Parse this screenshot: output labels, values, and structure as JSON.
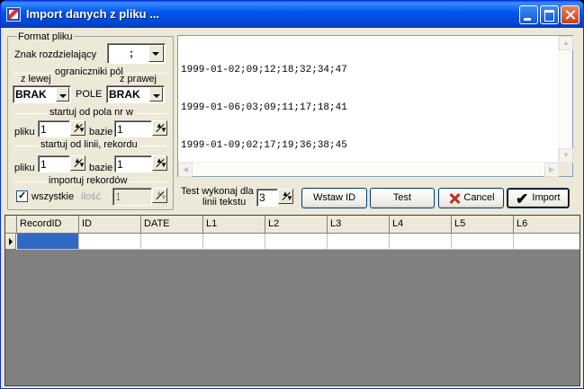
{
  "window": {
    "title": "Import danych z pliku ..."
  },
  "format": {
    "group_title": "Format pliku",
    "separator_label": "Znak rozdzielający",
    "separator_value": ";",
    "delimiters_title": "ograniczniki pól",
    "left_label": "z lewej",
    "right_label": "z prawej",
    "left_value": "BRAK",
    "right_value": "BRAK",
    "field_label": "POLE",
    "start_field_title": "startuj od pola nr w",
    "start_line_title": "startuj od linii, rekordu",
    "file_label": "pliku",
    "base_label": "bazie",
    "start_field_file": "1",
    "start_field_base": "1",
    "start_line_file": "1",
    "start_line_base": "1",
    "import_title": "importuj rekordów",
    "all_label": "wszystkie",
    "all_checked": true,
    "count_label": "ilość",
    "count_value": "1"
  },
  "preview": {
    "lines": [
      "1999-01-02;09;12;18;32;34;47",
      "1999-01-06;03;09;11;17;18;41",
      "1999-01-09;02;17;19;36;38;45"
    ]
  },
  "test": {
    "label_line1": "Test wykonaj dla",
    "label_line2": "linii tekstu",
    "lines_value": "3"
  },
  "buttons": {
    "insert_id": "Wstaw ID",
    "test": "Test",
    "cancel": "Cancel",
    "import": "Import"
  },
  "grid": {
    "columns": [
      "RecordID",
      "ID",
      "DATE",
      "L1",
      "L2",
      "L3",
      "L4",
      "L5",
      "L6"
    ]
  }
}
